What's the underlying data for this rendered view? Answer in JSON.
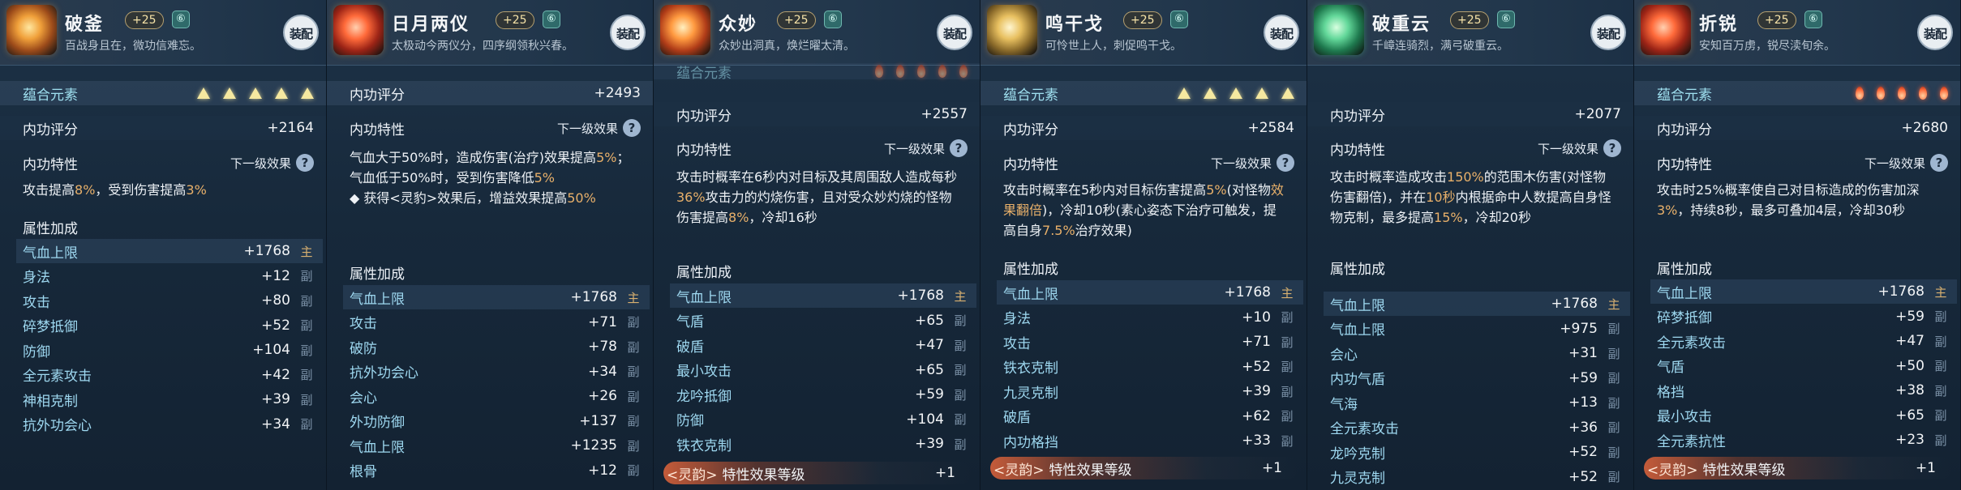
{
  "common": {
    "equip_label": "装配",
    "bind_glyph": "⑥",
    "element_label": "蕴合元素",
    "score_label": "内功评分",
    "trait_label": "内功特性",
    "next_effect_label": "下一级效果",
    "help_glyph": "?",
    "attr_title": "属性加成",
    "main_tag": "主",
    "sub_tag": "副",
    "lingyun_tag": "<灵韵>",
    "lingyun_name": "特性效果等级",
    "lingyun_value": "+1"
  },
  "panels": [
    {
      "name": "破釜",
      "level": "+25",
      "desc": "百战身且在，微功信难忘。",
      "element_icons": "triangle",
      "score": "+2164",
      "effect_parts": [
        {
          "t": "攻击提高",
          "h": false
        },
        {
          "t": "8%",
          "h": true
        },
        {
          "t": "，受到伤害提高",
          "h": false
        },
        {
          "t": "3%",
          "h": true
        }
      ],
      "attrs": [
        {
          "name": "气血上限",
          "value": "+1768",
          "tag": "main"
        },
        {
          "name": "身法",
          "value": "+12",
          "tag": "sub"
        },
        {
          "name": "攻击",
          "value": "+80",
          "tag": "sub"
        },
        {
          "name": "碎梦抵御",
          "value": "+52",
          "tag": "sub"
        },
        {
          "name": "防御",
          "value": "+104",
          "tag": "sub"
        },
        {
          "name": "全元素攻击",
          "value": "+42",
          "tag": "sub"
        },
        {
          "name": "神相克制",
          "value": "+39",
          "tag": "sub"
        },
        {
          "name": "抗外功会心",
          "value": "+34",
          "tag": "sub"
        }
      ]
    },
    {
      "name": "日月两仪",
      "level": "+25",
      "desc": "太极动今两仪分，四序纲领秋兴春。",
      "score": "+2493",
      "effect_parts": [
        {
          "t": "气血大于50%时，造成伤害(治疗)效果提高",
          "h": false
        },
        {
          "t": "5%",
          "h": true
        },
        {
          "t": "；气血低于50%时，受到伤害降低",
          "h": false
        },
        {
          "t": "5%",
          "h": true
        },
        {
          "t": "\n◆ 获得<灵豹>效果后，增益效果提高",
          "h": false
        },
        {
          "t": "50%",
          "h": true
        }
      ],
      "attrs": [
        {
          "name": "气血上限",
          "value": "+1768",
          "tag": "main"
        },
        {
          "name": "攻击",
          "value": "+71",
          "tag": "sub"
        },
        {
          "name": "破防",
          "value": "+78",
          "tag": "sub"
        },
        {
          "name": "抗外功会心",
          "value": "+34",
          "tag": "sub"
        },
        {
          "name": "会心",
          "value": "+26",
          "tag": "sub"
        },
        {
          "name": "外功防御",
          "value": "+137",
          "tag": "sub"
        },
        {
          "name": "气血上限",
          "value": "+1235",
          "tag": "sub"
        },
        {
          "name": "根骨",
          "value": "+12",
          "tag": "sub"
        }
      ]
    },
    {
      "name": "众妙",
      "level": "+25",
      "desc": "众妙出洞真，焕烂曜太清。",
      "element_icons": "flame",
      "score": "+2557",
      "effect_parts": [
        {
          "t": "攻击时概率在6秒内对目标及其周围敌人造成每秒",
          "h": false
        },
        {
          "t": "36%",
          "h": true
        },
        {
          "t": "攻击力的灼烧伤害，且对受众妙灼烧的怪物伤害提高",
          "h": false
        },
        {
          "t": "8%",
          "h": true
        },
        {
          "t": "，冷却16秒",
          "h": false
        }
      ],
      "attrs": [
        {
          "name": "气血上限",
          "value": "+1768",
          "tag": "main"
        },
        {
          "name": "气盾",
          "value": "+65",
          "tag": "sub"
        },
        {
          "name": "破盾",
          "value": "+47",
          "tag": "sub"
        },
        {
          "name": "最小攻击",
          "value": "+65",
          "tag": "sub"
        },
        {
          "name": "龙吟抵御",
          "value": "+59",
          "tag": "sub"
        },
        {
          "name": "防御",
          "value": "+104",
          "tag": "sub"
        },
        {
          "name": "铁衣克制",
          "value": "+39",
          "tag": "sub"
        }
      ]
    },
    {
      "name": "鸣干戈",
      "level": "+25",
      "desc": "可怜世上人，刺促鸣干戈。",
      "element_icons": "triangle",
      "score": "+2584",
      "effect_parts": [
        {
          "t": "攻击时概率在5秒内对目标伤害提高",
          "h": false
        },
        {
          "t": "5%",
          "h": true
        },
        {
          "t": "(对怪物",
          "h": false
        },
        {
          "t": "效果翻倍",
          "h": true
        },
        {
          "t": ")，冷却10秒(素心姿态下治疗可触发，提高自身",
          "h": false
        },
        {
          "t": "7.5%",
          "h": true
        },
        {
          "t": "治疗效果)",
          "h": false
        }
      ],
      "attrs": [
        {
          "name": "气血上限",
          "value": "+1768",
          "tag": "main"
        },
        {
          "name": "身法",
          "value": "+10",
          "tag": "sub"
        },
        {
          "name": "攻击",
          "value": "+71",
          "tag": "sub"
        },
        {
          "name": "铁衣克制",
          "value": "+52",
          "tag": "sub"
        },
        {
          "name": "九灵克制",
          "value": "+39",
          "tag": "sub"
        },
        {
          "name": "破盾",
          "value": "+62",
          "tag": "sub"
        },
        {
          "name": "内功格挡",
          "value": "+33",
          "tag": "sub"
        }
      ]
    },
    {
      "name": "破重云",
      "level": "+25",
      "desc": "千嶂连骑烈，满弓破重云。",
      "score": "+2077",
      "effect_parts": [
        {
          "t": "攻击时概率造成攻击",
          "h": false
        },
        {
          "t": "150%",
          "h": true
        },
        {
          "t": "的范围木伤害(对怪物伤害翻倍)，并在",
          "h": false
        },
        {
          "t": "10秒",
          "h": true
        },
        {
          "t": "内根据命中人数提高自身怪物克制，最多提高",
          "h": false
        },
        {
          "t": "15%",
          "h": true
        },
        {
          "t": "，冷却20秒",
          "h": false
        }
      ],
      "attrs": [
        {
          "name": "气血上限",
          "value": "+1768",
          "tag": "main"
        },
        {
          "name": "气血上限",
          "value": "+975",
          "tag": "sub"
        },
        {
          "name": "会心",
          "value": "+31",
          "tag": "sub"
        },
        {
          "name": "内功气盾",
          "value": "+59",
          "tag": "sub"
        },
        {
          "name": "气海",
          "value": "+13",
          "tag": "sub"
        },
        {
          "name": "全元素攻击",
          "value": "+36",
          "tag": "sub"
        },
        {
          "name": "龙吟克制",
          "value": "+52",
          "tag": "sub"
        },
        {
          "name": "九灵克制",
          "value": "+52",
          "tag": "sub"
        }
      ]
    },
    {
      "name": "折锐",
      "level": "+25",
      "desc": "安知百万虏，锐尽渎旬余。",
      "element_icons": "flame",
      "score": "+2680",
      "effect_parts": [
        {
          "t": "攻击时25%概率使自己对目标造成的伤害加深",
          "h": false
        },
        {
          "t": "3%",
          "h": true
        },
        {
          "t": "，持续8秒，最多可叠加4层，冷却30秒",
          "h": false
        }
      ],
      "attrs": [
        {
          "name": "气血上限",
          "value": "+1768",
          "tag": "main"
        },
        {
          "name": "碎梦抵御",
          "value": "+59",
          "tag": "sub"
        },
        {
          "name": "全元素攻击",
          "value": "+47",
          "tag": "sub"
        },
        {
          "name": "气盾",
          "value": "+50",
          "tag": "sub"
        },
        {
          "name": "格挡",
          "value": "+38",
          "tag": "sub"
        },
        {
          "name": "最小攻击",
          "value": "+65",
          "tag": "sub"
        },
        {
          "name": "全元素抗性",
          "value": "+23",
          "tag": "sub"
        }
      ]
    }
  ]
}
